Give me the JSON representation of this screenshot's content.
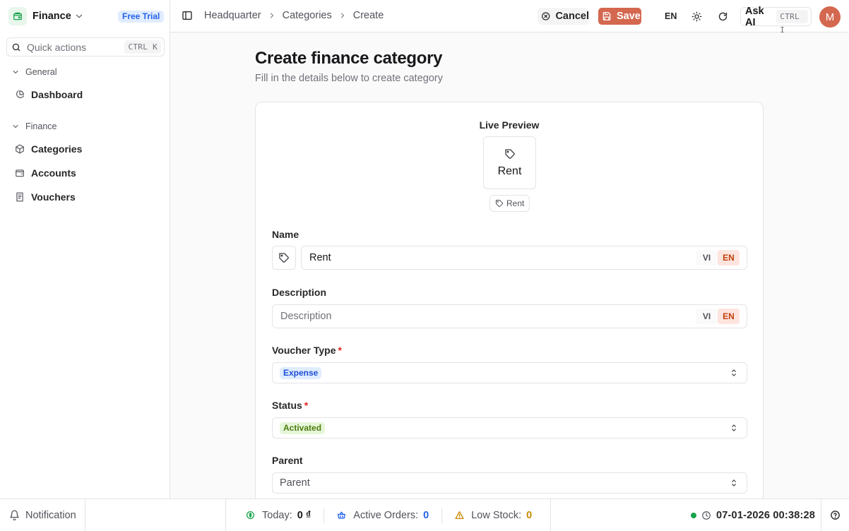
{
  "sidebar": {
    "brand": "Finance",
    "trial_badge": "Free Trial",
    "quick_actions": {
      "placeholder": "Quick actions",
      "shortcut": "CTRL K"
    },
    "groups": [
      {
        "label": "General",
        "items": [
          {
            "label": "Dashboard",
            "icon": "pie-chart-icon"
          }
        ]
      },
      {
        "label": "Finance",
        "items": [
          {
            "label": "Categories",
            "icon": "package-icon"
          },
          {
            "label": "Accounts",
            "icon": "wallet-icon"
          },
          {
            "label": "Vouchers",
            "icon": "receipt-icon"
          }
        ]
      }
    ]
  },
  "header": {
    "breadcrumbs": [
      "Headquarter",
      "Categories",
      "Create"
    ],
    "cancel_label": "Cancel",
    "save_label": "Save",
    "language": "EN",
    "ask_ai": {
      "label": "Ask AI",
      "shortcut": "CTRL I"
    },
    "avatar_initial": "M",
    "colors": {
      "primary": "#d4674f"
    }
  },
  "page": {
    "title": "Create finance category",
    "subtitle": "Fill in the details below to create category"
  },
  "preview": {
    "label": "Live Preview",
    "name": "Rent",
    "pill": "Rent"
  },
  "form": {
    "name": {
      "label": "Name",
      "value": "Rent",
      "lang_vi": "VI",
      "lang_en": "EN"
    },
    "description": {
      "label": "Description",
      "placeholder": "Description",
      "value": "",
      "lang_vi": "VI",
      "lang_en": "EN"
    },
    "voucher_type": {
      "label": "Voucher Type",
      "required": "*",
      "value": "Expense"
    },
    "status": {
      "label": "Status",
      "required": "*",
      "value": "Activated"
    },
    "parent": {
      "label": "Parent",
      "placeholder": "Parent"
    }
  },
  "footer": {
    "notification": "Notification",
    "today": {
      "label": "Today:",
      "value": "0 ₫"
    },
    "active_orders": {
      "label": "Active Orders:",
      "value": "0"
    },
    "low_stock": {
      "label": "Low Stock:",
      "value": "0"
    },
    "datetime": "07-01-2026 00:38:28"
  }
}
